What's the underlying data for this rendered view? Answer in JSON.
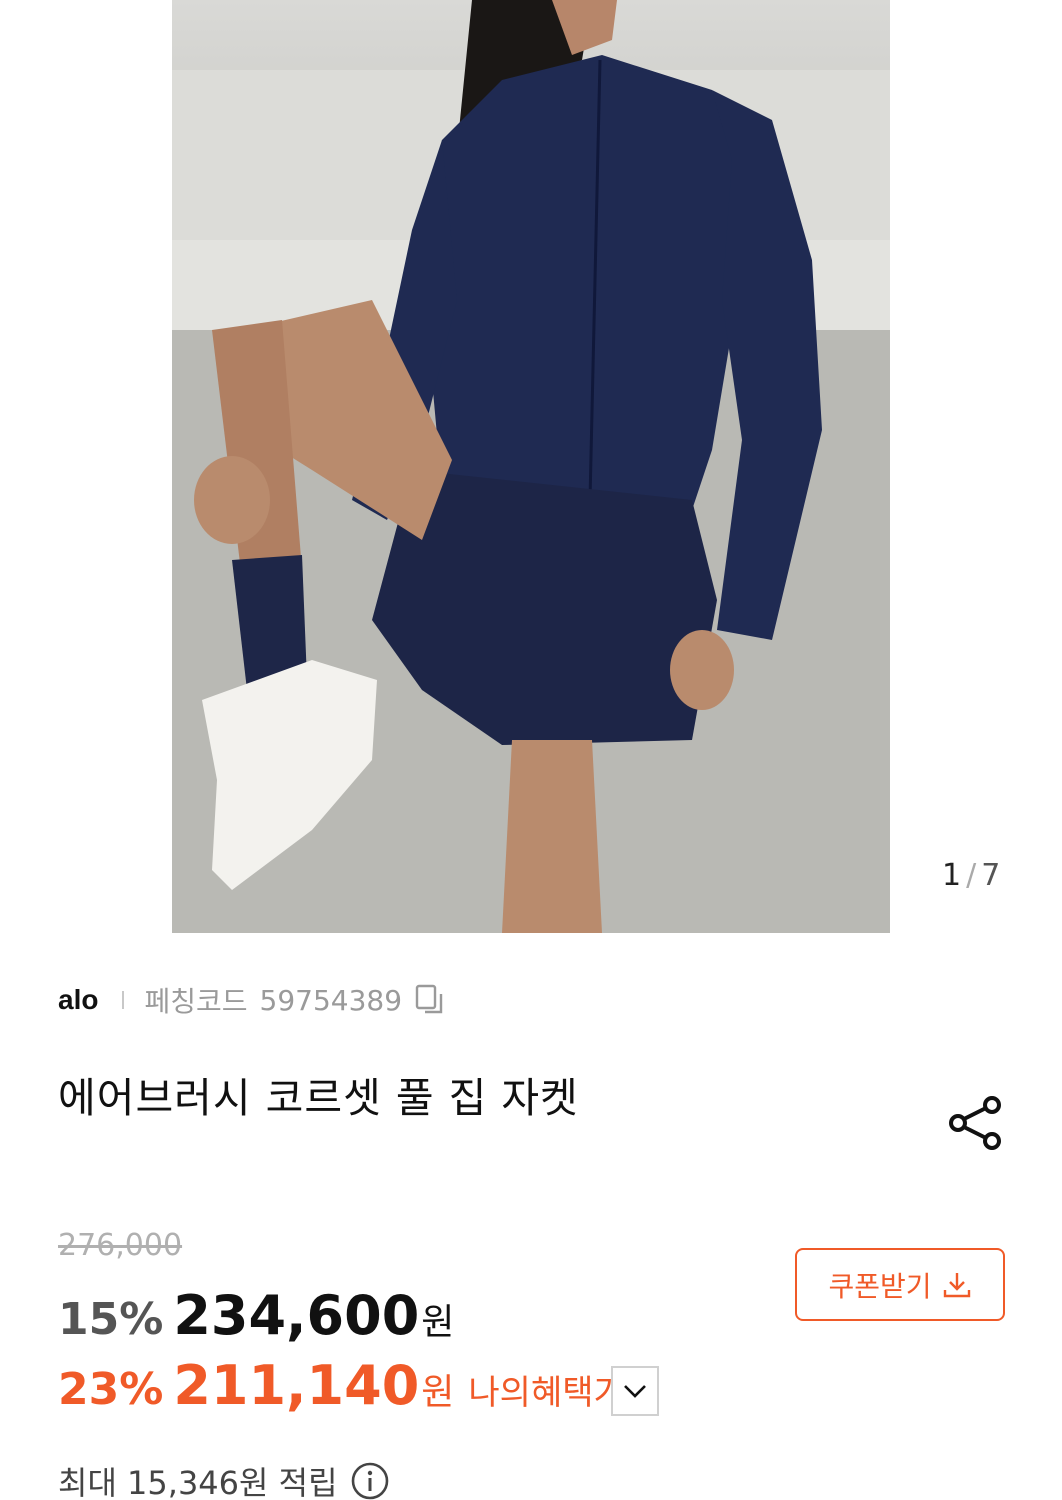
{
  "gallery": {
    "current": "1",
    "separator": "/",
    "total": "7"
  },
  "product": {
    "brand": "alo",
    "code_label": "페칭코드",
    "code_value": "59754389",
    "title": "에어브러시 코르셋 풀 집 자켓"
  },
  "pricing": {
    "original_price": "276,000",
    "sale_rate": "15%",
    "sale_price": "234,600",
    "currency": "원",
    "benefit_rate": "23%",
    "benefit_price": "211,140",
    "benefit_label": "나의혜택가"
  },
  "coupon": {
    "label": "쿠폰받기"
  },
  "points": {
    "label": "최대 15,346원 적립"
  },
  "colors": {
    "accent": "#f05a28",
    "text": "#111111",
    "muted": "#9a9a9a"
  },
  "icons": [
    "copy-icon",
    "share-icon",
    "download-icon",
    "chevron-down-icon",
    "info-icon"
  ]
}
